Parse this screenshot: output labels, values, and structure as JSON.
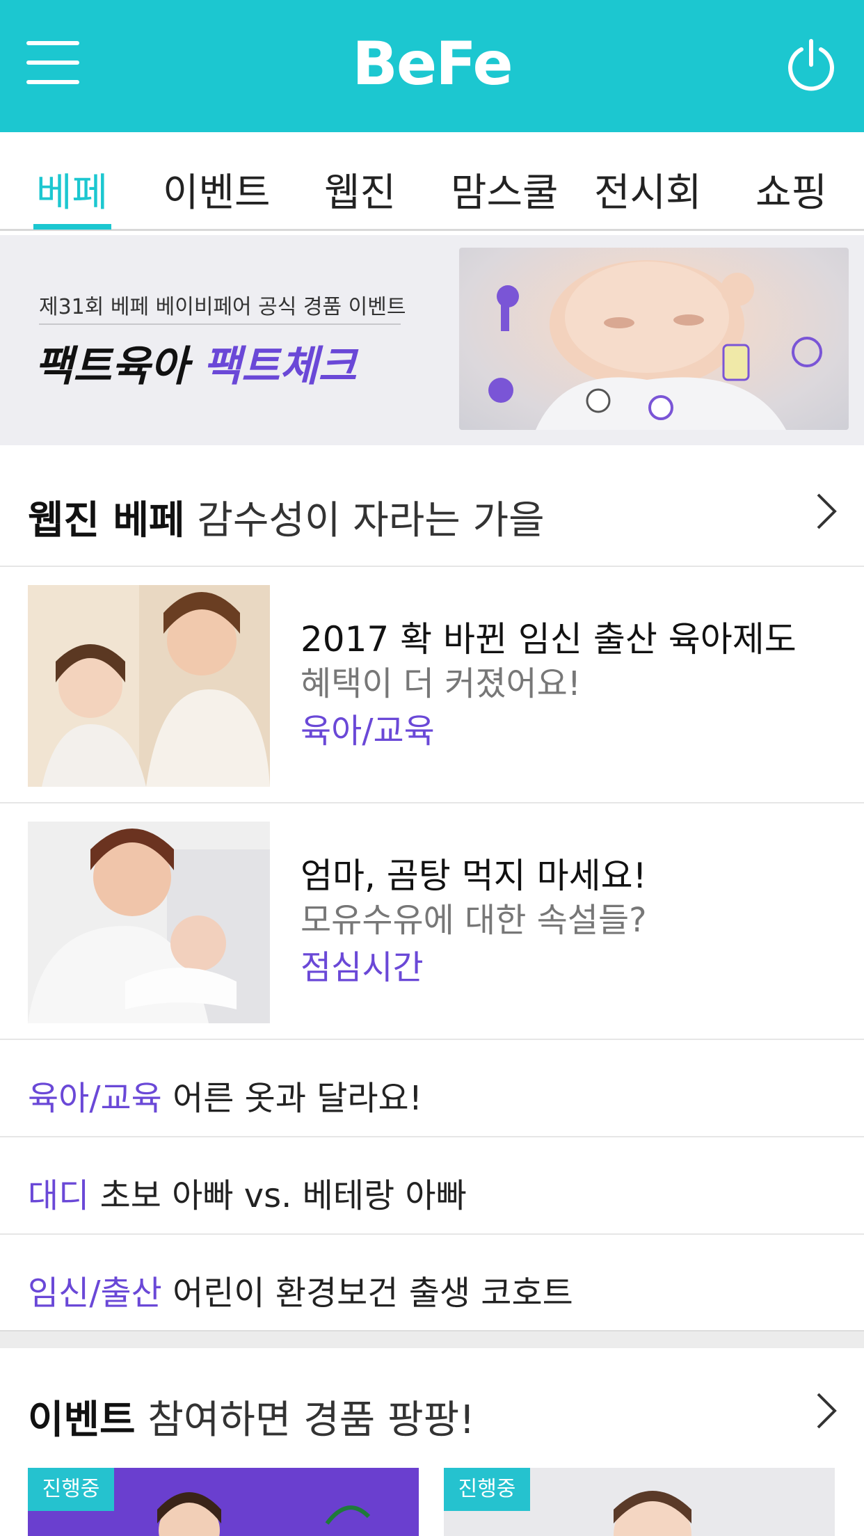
{
  "header": {
    "logo": "BeFe",
    "menu_icon": "hamburger-menu-icon",
    "power_icon": "power-icon",
    "background": "#1cc7d0"
  },
  "tabs": [
    {
      "label": "베페",
      "active": true
    },
    {
      "label": "이벤트"
    },
    {
      "label": "웹진"
    },
    {
      "label": "맘스쿨"
    },
    {
      "label": "전시회"
    },
    {
      "label": "쇼핑"
    }
  ],
  "banner": {
    "subtitle": "제31회 베페 베이비페어 공식 경품 이벤트",
    "title_part1": "팩트육아",
    "title_part2": "팩트체크"
  },
  "webzine": {
    "title_bold": "웹진 베페",
    "title_rest": "감수성이 자라는 가을",
    "articles": [
      {
        "headline": "2017 확 바뀐 임신 출산 육아제도",
        "sub": "혜택이 더 커졌어요!",
        "category": "육아/교육"
      },
      {
        "headline": "엄마, 곰탕 먹지 마세요!",
        "sub": "모유수유에 대한 속설들?",
        "category": "점심시간"
      }
    ],
    "list": [
      {
        "category": "육아/교육",
        "text": "어른 옷과 달라요!"
      },
      {
        "category": "대디",
        "text": "초보 아빠 vs. 베테랑 아빠"
      },
      {
        "category": "임신/출산",
        "text": "어린이 환경보건 출생 코호트"
      }
    ]
  },
  "events": {
    "title_bold": "이벤트",
    "title_rest": "참여하면 경품 팡팡!",
    "items": [
      {
        "badge": "진행중"
      },
      {
        "badge": "진행중"
      }
    ]
  },
  "colors": {
    "accent": "#1cc7d0",
    "category": "#6a48d7"
  }
}
